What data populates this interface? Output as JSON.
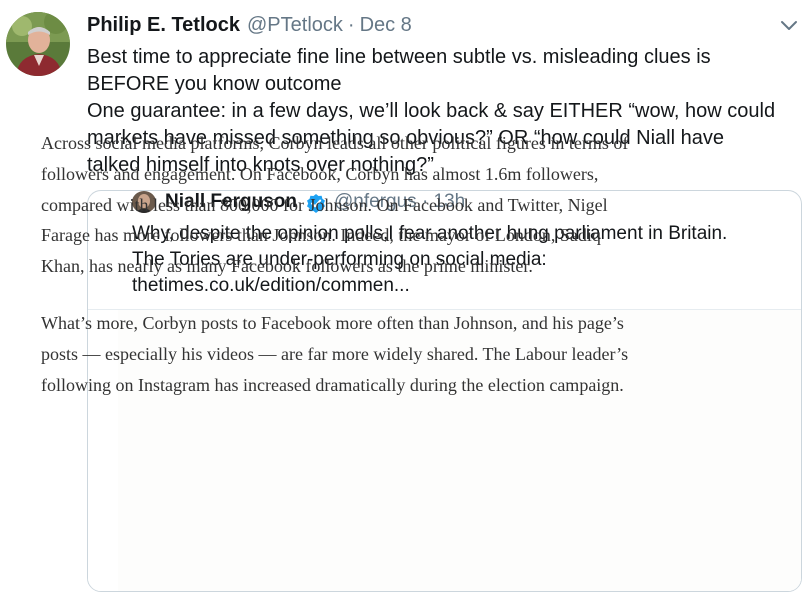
{
  "tweet": {
    "author_name": "Philip E. Tetlock",
    "author_handle": "@PTetlock",
    "separator": "·",
    "date": "Dec 8",
    "avatar_icon": "profile-photo",
    "menu_icon": "chevron-down-icon",
    "text_lines": [
      "Best time to appreciate fine line between subtle vs. misleading clues is",
      "BEFORE you know outcome",
      "One guarantee: in a few days, we’ll look back & say EITHER “wow, how could",
      "markets have missed something so obvious?” OR “how could Niall have",
      "talked himself into knots over nothing?”"
    ]
  },
  "quoted_tweet": {
    "author_name": "Niall Ferguson",
    "verified_icon": "verified-badge-icon",
    "author_handle": "@nfergus · 13h",
    "text_lines": [
      "Why, despite the opinion polls,I fear another hung parliament in Britain.",
      "The Tories are under-performing on social media:",
      "thetimes.co.uk/edition/commen..."
    ],
    "article_image": {
      "paragraph1": [
        "Across social media platforms, Corbyn leads all other political figures in terms of",
        "followers and engagement. On Facebook, Corbyn has almost 1.6m followers,",
        "compared with less than 800,000 for Johnson. On Facebook and Twitter, Nigel",
        "Farage has more followers than Johnson. Indeed, the mayor of London, Sadiq",
        "Khan, has nearly as many Facebook followers as the prime minister."
      ],
      "paragraph2": [
        "What’s more, Corbyn posts to Facebook more often than Johnson, and his page’s",
        "posts — especially his videos — are far more widely shared. The Labour leader’s",
        "following on Instagram has increased dramatically during the election campaign."
      ]
    }
  },
  "colors": {
    "text": "#14171a",
    "secondary": "#657786",
    "border": "#ccd6dd",
    "verified": "#1da1f2"
  }
}
